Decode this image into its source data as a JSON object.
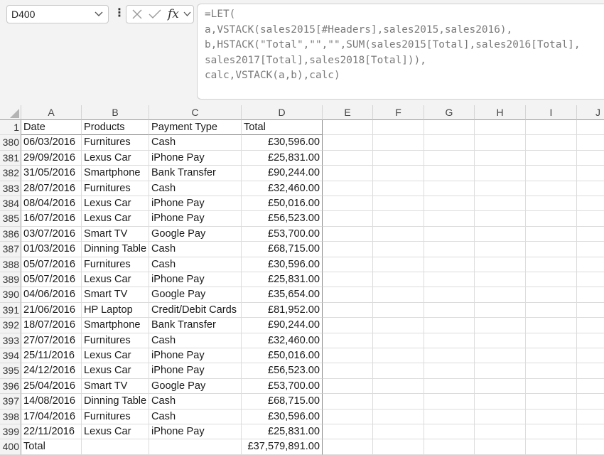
{
  "name_box": {
    "value": "D400"
  },
  "formula_bar": {
    "fx_label": "fx",
    "lines": [
      "=LET(",
      "a,VSTACK(sales2015[#Headers],sales2015,sales2016),",
      "b,HSTACK(\"Total\",\"\",\"\",SUM(sales2015[Total],sales2016[Total],",
      "sales2017[Total],sales2018[Total])),",
      "calc,VSTACK(a,b),calc)"
    ]
  },
  "columns": [
    "A",
    "B",
    "C",
    "D",
    "E",
    "F",
    "G",
    "H",
    "I",
    "J"
  ],
  "header_row": {
    "row": "1",
    "cells": [
      "Date",
      "Products",
      "Payment Type",
      "Total"
    ]
  },
  "rows": [
    {
      "row": "380",
      "cells": [
        "06/03/2016",
        "Furnitures",
        "Cash",
        "£30,596.00"
      ]
    },
    {
      "row": "381",
      "cells": [
        "29/09/2016",
        "Lexus Car",
        "iPhone Pay",
        "£25,831.00"
      ]
    },
    {
      "row": "382",
      "cells": [
        "31/05/2016",
        "Smartphone",
        "Bank Transfer",
        "£90,244.00"
      ]
    },
    {
      "row": "383",
      "cells": [
        "28/07/2016",
        "Furnitures",
        "Cash",
        "£32,460.00"
      ]
    },
    {
      "row": "384",
      "cells": [
        "08/04/2016",
        "Lexus Car",
        "iPhone Pay",
        "£50,016.00"
      ]
    },
    {
      "row": "385",
      "cells": [
        "16/07/2016",
        "Lexus Car",
        "iPhone Pay",
        "£56,523.00"
      ]
    },
    {
      "row": "386",
      "cells": [
        "03/07/2016",
        "Smart TV",
        "Google Pay",
        "£53,700.00"
      ]
    },
    {
      "row": "387",
      "cells": [
        "01/03/2016",
        "Dinning Table",
        "Cash",
        "£68,715.00"
      ]
    },
    {
      "row": "388",
      "cells": [
        "05/07/2016",
        "Furnitures",
        "Cash",
        "£30,596.00"
      ]
    },
    {
      "row": "389",
      "cells": [
        "05/07/2016",
        "Lexus Car",
        "iPhone Pay",
        "£25,831.00"
      ]
    },
    {
      "row": "390",
      "cells": [
        "04/06/2016",
        "Smart TV",
        "Google Pay",
        "£35,654.00"
      ]
    },
    {
      "row": "391",
      "cells": [
        "21/06/2016",
        "HP Laptop",
        "Credit/Debit Cards",
        "£81,952.00"
      ]
    },
    {
      "row": "392",
      "cells": [
        "18/07/2016",
        "Smartphone",
        "Bank Transfer",
        "£90,244.00"
      ]
    },
    {
      "row": "393",
      "cells": [
        "27/07/2016",
        "Furnitures",
        "Cash",
        "£32,460.00"
      ]
    },
    {
      "row": "394",
      "cells": [
        "25/11/2016",
        "Lexus Car",
        "iPhone Pay",
        "£50,016.00"
      ]
    },
    {
      "row": "395",
      "cells": [
        "24/12/2016",
        "Lexus Car",
        "iPhone Pay",
        "£56,523.00"
      ]
    },
    {
      "row": "396",
      "cells": [
        "25/04/2016",
        "Smart TV",
        "Google Pay",
        "£53,700.00"
      ]
    },
    {
      "row": "397",
      "cells": [
        "14/08/2016",
        "Dinning Table",
        "Cash",
        "£68,715.00"
      ]
    },
    {
      "row": "398",
      "cells": [
        "17/04/2016",
        "Furnitures",
        "Cash",
        "£30,596.00"
      ]
    },
    {
      "row": "399",
      "cells": [
        "22/11/2016",
        "Lexus Car",
        "iPhone Pay",
        "£25,831.00"
      ]
    },
    {
      "row": "400",
      "cells": [
        "Total",
        "",
        "",
        "£37,579,891.00"
      ]
    }
  ]
}
